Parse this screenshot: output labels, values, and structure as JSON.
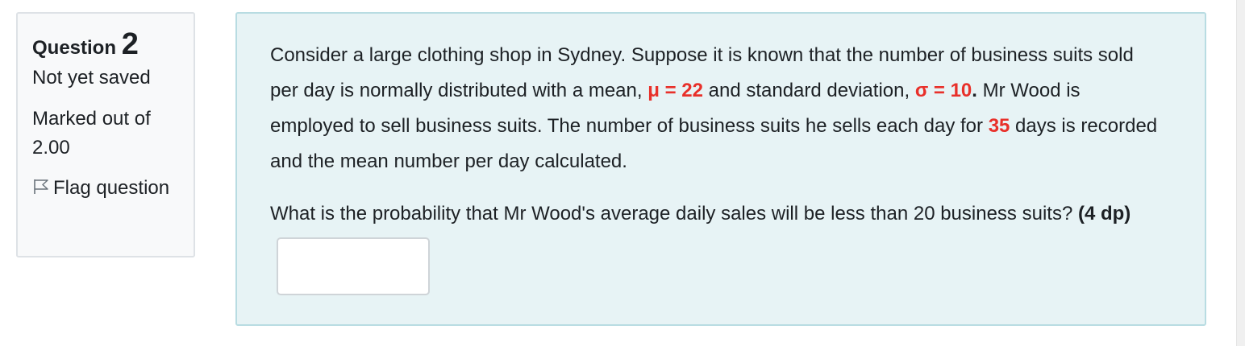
{
  "info": {
    "question_label": "Question",
    "question_number": "2",
    "state": "Not yet saved",
    "grade": "Marked out of 2.00",
    "flag_label": "Flag question"
  },
  "question": {
    "p1_a": "Consider a large clothing shop in Sydney. Suppose it is known that the number of business suits sold per day is normally distributed with a mean, ",
    "mu": "μ = 22",
    "p1_b": " and standard deviation, ",
    "sigma": "σ = 10",
    "p1_c": ".",
    "p1_d": " Mr Wood is employed to sell business suits. The number of business suits he sells each day for ",
    "days": "35",
    "p1_e": " days is recorded and the mean number per day calculated.",
    "prompt": "What is the probability that Mr Wood's average daily sales will be less than 20 business suits? ",
    "dp": "(4 dp)",
    "answer_value": ""
  },
  "colors": {
    "highlight": "#e8302a",
    "content_bg": "#e7f3f5",
    "info_bg": "#f8f9fa"
  }
}
